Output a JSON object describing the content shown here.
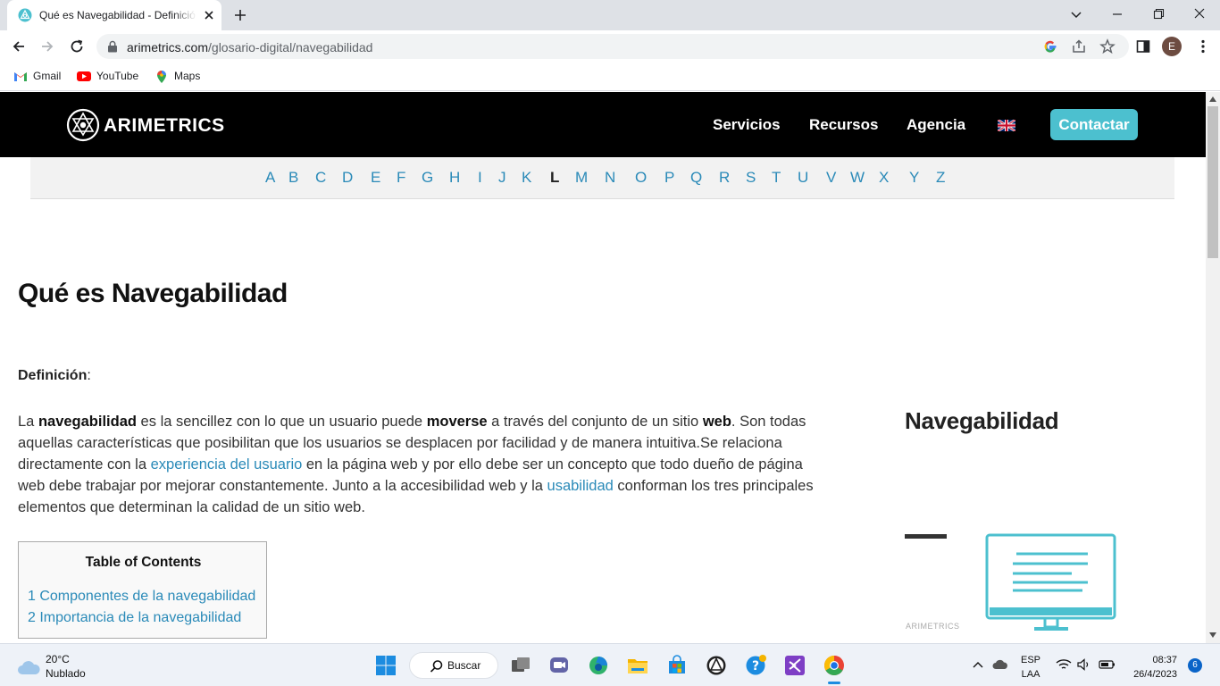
{
  "browser": {
    "tab_title": "Qué es Navegabilidad - Definición",
    "url_domain": "arimetrics.com",
    "url_path": "/glosario-digital/navegabilidad",
    "profile_initial": "E",
    "bookmarks": [
      "Gmail",
      "YouTube",
      "Maps"
    ]
  },
  "site": {
    "brand": "ARIMETRICS",
    "nav": [
      "Servicios",
      "Recursos",
      "Agencia"
    ],
    "contact_label": "Contactar",
    "accent_color": "#4cc0cf",
    "link_color": "#2a8ab8"
  },
  "alphabet": {
    "letters": [
      "A",
      "B",
      "C",
      "D",
      "E",
      "F",
      "G",
      "H",
      "I",
      "J",
      "K",
      "L",
      "M",
      "N",
      "O",
      "P",
      "Q",
      "R",
      "S",
      "T",
      "U",
      "V",
      "W",
      "X",
      "Y",
      "Z"
    ],
    "active": "L"
  },
  "article": {
    "title": "Qué es Navegabilidad",
    "definition_label": "Definición",
    "definition_colon": ":",
    "p_1": "La ",
    "p_b1": "navegabilidad",
    "p_2": " es la sencillez con lo que un usuario puede ",
    "p_b2": "moverse",
    "p_3": " a través del conjunto de un sitio ",
    "p_b3": "web",
    "p_4": ". Son todas aquellas características que posibilitan que los usuarios se desplacen por facilidad y de manera intuitiva.Se relaciona directamente con la ",
    "p_link1": "experiencia del usuario",
    "p_5": " en la página web y por ello debe ser un concepto que todo dueño de página web debe trabajar por mejorar constantemente. Junto a la accesibilidad web y la ",
    "p_link2": "usabilidad",
    "p_6": " conforman los tres principales elementos que determinan la calidad de un sitio web."
  },
  "toc": {
    "title": "Table of Contents",
    "items": [
      "1 Componentes de la navegabilidad",
      "2 Importancia de la navegabilidad"
    ]
  },
  "sidebar": {
    "title": "Navegabilidad",
    "image_brand": "ARIMETRICS"
  },
  "taskbar": {
    "temp": "20°C",
    "weather": "Nublado",
    "search_label": "Buscar",
    "lang1": "ESP",
    "lang2": "LAA",
    "time": "08:37",
    "date": "26/4/2023",
    "notifications": "6"
  }
}
